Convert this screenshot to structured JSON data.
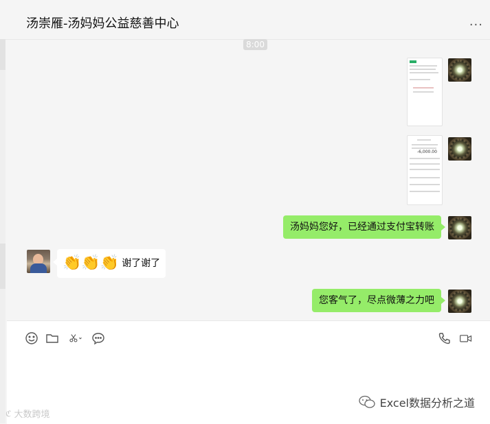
{
  "window": {
    "pin_icon": "pin-icon",
    "minimize_icon": "minimize-icon",
    "maximize_icon": "maximize-icon",
    "close_icon": "close-icon",
    "pin_glyph": "卒",
    "minimize_glyph": "—",
    "maximize_glyph": "☐",
    "close_glyph": "✕"
  },
  "header": {
    "title": "汤崇雁-汤妈妈公益慈善中心",
    "more_glyph": "···"
  },
  "messages": {
    "time": "8:00",
    "items": [
      {
        "type": "image",
        "from": "me"
      },
      {
        "type": "image",
        "from": "me"
      },
      {
        "type": "text",
        "from": "me",
        "text": "汤妈妈您好，已经通过支付宝转账"
      },
      {
        "type": "text",
        "from": "other",
        "emoji": "👏👏👏",
        "text": "谢了谢了"
      },
      {
        "type": "text",
        "from": "me",
        "text": "您客气了，尽点微薄之力吧"
      }
    ],
    "image_amount": "-6,000.00"
  },
  "composer": {
    "tools": [
      "emoji-icon",
      "folder-icon",
      "scissors-icon",
      "chat-bubble-icon"
    ],
    "right_tools": [
      "phone-icon",
      "video-icon"
    ]
  },
  "watermarks": {
    "right_text": "Excel数据分析之道",
    "left_text": "大数跨境"
  },
  "colors": {
    "bubble_me": "#95ec69",
    "bubble_other": "#ffffff",
    "background": "#f5f5f5"
  }
}
